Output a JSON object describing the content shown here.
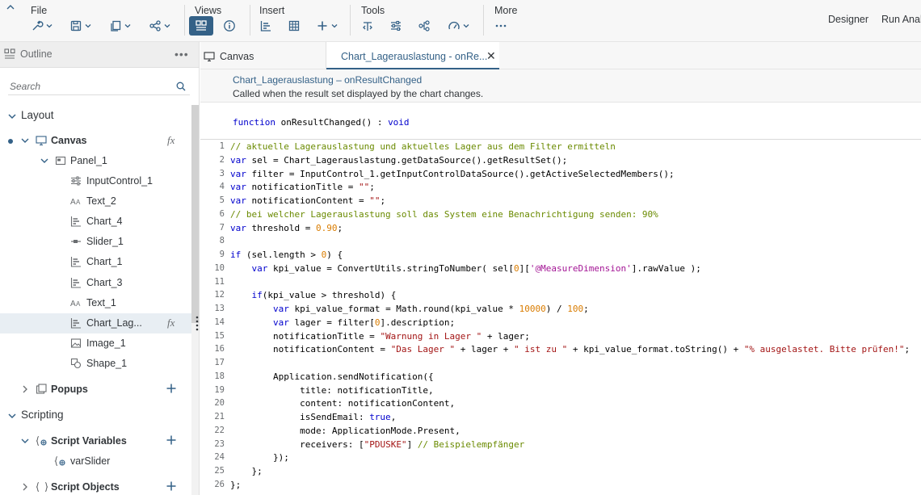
{
  "toolbar": {
    "groups": {
      "file": "File",
      "views": "Views",
      "insert": "Insert",
      "tools": "Tools",
      "more": "More"
    },
    "right_links": [
      "Designer",
      "Run Analy"
    ],
    "active_view_icon": "outline-view-icon"
  },
  "outline": {
    "title": "Outline",
    "more": "•••",
    "search_placeholder": "Search",
    "sections": {
      "layout": "Layout",
      "scripting": "Scripting"
    },
    "canvas": "Canvas",
    "panel": "Panel_1",
    "items": [
      {
        "label": "InputControl_1",
        "icon": "input-control-icon"
      },
      {
        "label": "Text_2",
        "icon": "text-icon"
      },
      {
        "label": "Chart_4",
        "icon": "chart-icon"
      },
      {
        "label": "Slider_1",
        "icon": "slider-icon"
      },
      {
        "label": "Chart_1",
        "icon": "chart-icon"
      },
      {
        "label": "Chart_3",
        "icon": "chart-icon"
      },
      {
        "label": "Text_1",
        "icon": "text-icon"
      },
      {
        "label": "Chart_Lag...",
        "icon": "chart-icon"
      },
      {
        "label": "Image_1",
        "icon": "image-icon"
      },
      {
        "label": "Shape_1",
        "icon": "shape-icon"
      }
    ],
    "popups": "Popups",
    "script_variables": "Script Variables",
    "var_slider": "varSlider",
    "script_objects": "Script Objects",
    "fx": "fx",
    "selected_item": "Chart_Lag..."
  },
  "tabs": [
    {
      "label": "Canvas",
      "icon": "monitor-icon",
      "active": false
    },
    {
      "label": "Chart_Lagerauslastung - onRe...",
      "active": true
    }
  ],
  "editor": {
    "event_title": "Chart_Lagerauslastung – onResultChanged",
    "event_desc": "Called when the result set displayed by the chart changes.",
    "signature_kw": "function",
    "signature_name": " onResultChanged() : ",
    "signature_ret": "void",
    "lines": [
      "// aktuelle Lagerauslastung und aktuelles Lager aus dem Filter ermitteln",
      "var sel = Chart_Lagerauslastung.getDataSource().getResultSet();",
      "var filter = InputControl_1.getInputControlDataSource().getActiveSelectedMembers();",
      "var notificationTitle = \"\";",
      "var notificationContent = \"\";",
      "// bei welcher Lagerauslastung soll das System eine Benachrichtigung senden: 90%",
      "var threshold = 0.90;",
      "",
      "if (sel.length > 0) {",
      "    var kpi_value = ConvertUtils.stringToNumber( sel[0]['@MeasureDimension'].rawValue );",
      "",
      "    if(kpi_value > threshold) {",
      "        var kpi_value_format = Math.round(kpi_value * 10000) / 100;",
      "        var lager = filter[0].description;",
      "        notificationTitle = \"Warnung in Lager \" + lager;",
      "        notificationContent = \"Das Lager \" + lager + \" ist zu \" + kpi_value_format.toString() + \"% ausgelastet. Bitte prüfen!\";",
      "",
      "        Application.sendNotification({",
      "             title: notificationTitle,",
      "             content: notificationContent,",
      "             isSendEmail: true,",
      "             mode: ApplicationMode.Present,",
      "             receivers: [\"PDUSKE\"] // Beispielempfänger",
      "        });",
      "    };",
      "};"
    ]
  }
}
